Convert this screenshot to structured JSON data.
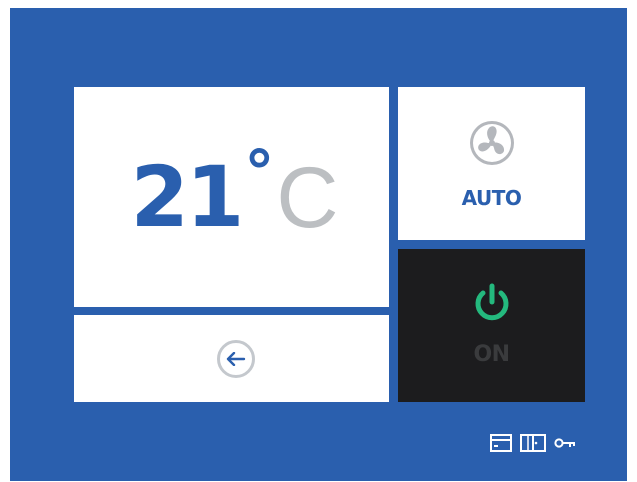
{
  "temperature": {
    "value": "21",
    "degree_symbol": "°",
    "unit": "C"
  },
  "back_button": {
    "icon": "arrow-left-icon"
  },
  "fan": {
    "icon": "fan-icon",
    "mode_label": "AUTO"
  },
  "power": {
    "icon": "power-icon",
    "state_label": "ON"
  },
  "status_icons": [
    "keycard-icon",
    "door-icon",
    "key-icon"
  ],
  "colors": {
    "background": "#2a5fae",
    "tile": "#ffffff",
    "accent_blue": "#2a5fae",
    "unit_gray": "#bcbfc2",
    "power_tile": "#1c1c1e",
    "power_green": "#24b97e",
    "power_label": "#3a3b3d",
    "fan_icon_gray": "#b4b7bc"
  }
}
